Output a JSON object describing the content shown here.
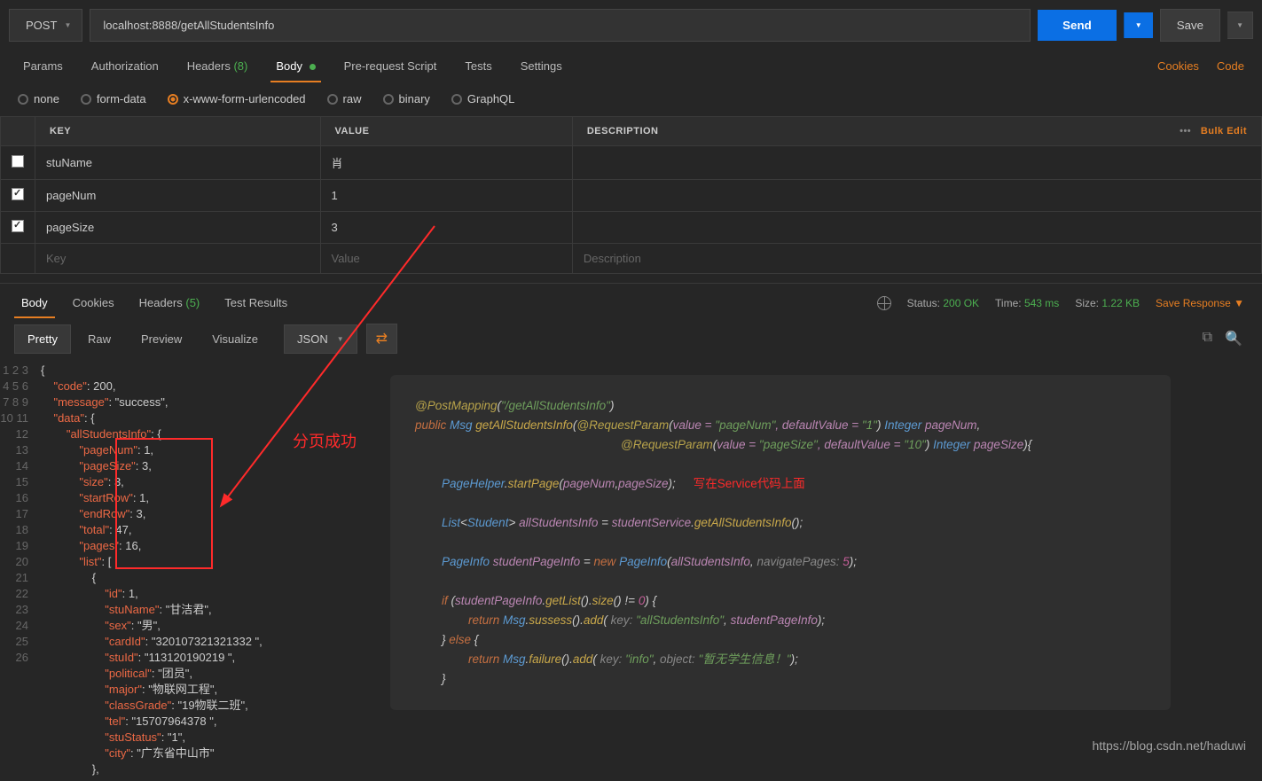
{
  "request": {
    "method": "POST",
    "url": "localhost:8888/getAllStudentsInfo",
    "send": "Send",
    "save": "Save"
  },
  "reqTabs": {
    "params": "Params",
    "auth": "Authorization",
    "headers": "Headers",
    "headersCount": "(8)",
    "body": "Body",
    "prs": "Pre-request Script",
    "tests": "Tests",
    "settings": "Settings",
    "cookies": "Cookies",
    "code": "Code"
  },
  "bodyTypes": {
    "none": "none",
    "formdata": "form-data",
    "urlencoded": "x-www-form-urlencoded",
    "raw": "raw",
    "binary": "binary",
    "graphql": "GraphQL"
  },
  "kv": {
    "headers": {
      "key": "KEY",
      "value": "VALUE",
      "desc": "DESCRIPTION",
      "bulk": "Bulk Edit"
    },
    "rows": [
      {
        "checked": false,
        "k": "stuName",
        "v": "肖"
      },
      {
        "checked": true,
        "k": "pageNum",
        "v": "1"
      },
      {
        "checked": true,
        "k": "pageSize",
        "v": "3"
      }
    ],
    "placeholders": {
      "k": "Key",
      "v": "Value",
      "d": "Description"
    }
  },
  "respTabs": {
    "body": "Body",
    "cookies": "Cookies",
    "headers": "Headers",
    "headersCount": "(5)",
    "tr": "Test Results"
  },
  "status": {
    "statusLabel": "Status:",
    "statusVal": "200 OK",
    "timeLabel": "Time:",
    "timeVal": "543 ms",
    "sizeLabel": "Size:",
    "sizeVal": "1.22 KB",
    "saveResp": "Save Response"
  },
  "viewTabs": {
    "pretty": "Pretty",
    "raw": "Raw",
    "preview": "Preview",
    "visualize": "Visualize",
    "format": "JSON"
  },
  "json": {
    "1": "{",
    "2": "    \"code\": 200,",
    "3": "    \"message\": \"success\",",
    "4": "    \"data\": {",
    "5": "        \"allStudentsInfo\": {",
    "6": "            \"pageNum\": 1,",
    "7": "            \"pageSize\": 3,",
    "8": "            \"size\": 3,",
    "9": "            \"startRow\": 1,",
    "10": "            \"endRow\": 3,",
    "11": "            \"total\": 47,",
    "12": "            \"pages\": 16,",
    "13": "            \"list\": [",
    "14": "                {",
    "15": "                    \"id\": 1,",
    "16": "                    \"stuName\": \"甘洁君\",",
    "17": "                    \"sex\": \"男\",",
    "18": "                    \"cardId\": \"320107321321332 \",",
    "19": "                    \"stuId\": \"113120190219 \",",
    "20": "                    \"political\": \"团员\",",
    "21": "                    \"major\": \"物联网工程\",",
    "22": "                    \"classGrade\": \"19物联二班\",",
    "23": "                    \"tel\": \"15707964378 \",",
    "24": "                    \"stuStatus\": \"1\",",
    "25": "                    \"city\": \"广东省中山市\"",
    "26": "                },"
  },
  "anno": {
    "pagination": "分页成功",
    "serviceNote": "写在Service代码上面"
  },
  "overlay": {
    "l1a": "@PostMapping",
    "l1b": "(",
    "l1c": "\"/getAllStudentsInfo\"",
    "l1d": ")",
    "l2a": "public ",
    "l2b": "Msg ",
    "l2c": "getAllStudentsInfo",
    "l2d": "(",
    "l2e": "@RequestParam",
    "l2f": "(",
    "l2g": "value = ",
    "l2h": "\"pageNum\"",
    "l2i": ", defaultValue = ",
    "l2j": "\"1\"",
    "l2k": ") ",
    "l2l": "Integer ",
    "l2m": "pageNum",
    "l2n": ",",
    "l3e": "@RequestParam",
    "l3f": "(",
    "l3g": "value = ",
    "l3h": "\"pageSize\"",
    "l3i": ", defaultValue = ",
    "l3j": "\"10\"",
    "l3k": ") ",
    "l3l": "Integer ",
    "l3m": "pageSize",
    "l3n": "){",
    "l4a": "PageHelper",
    "l4b": ".",
    "l4c": "startPage",
    "l4d": "(",
    "l4e": "pageNum",
    "l4f": ",",
    "l4g": "pageSize",
    "l4h": ");",
    "l5a": "List",
    "l5b": "<",
    "l5c": "Student",
    "l5d": "> ",
    "l5e": "allStudentsInfo",
    "l5f": " = ",
    "l5g": "studentService",
    "l5h": ".",
    "l5i": "getAllStudentsInfo",
    "l5j": "();",
    "l6a": "PageInfo ",
    "l6b": "studentPageInfo",
    "l6c": " = ",
    "l6d": "new ",
    "l6e": "PageInfo",
    "l6f": "(",
    "l6g": "allStudentsInfo",
    "l6h": ",  ",
    "l6i": "navigatePages: ",
    "l6j": "5",
    "l6k": ");",
    "l7a": "if ",
    "l7b": "(",
    "l7c": "studentPageInfo",
    "l7d": ".",
    "l7e": "getList",
    "l7f": "().",
    "l7g": "size",
    "l7h": "() != ",
    "l7i": "0",
    "l7j": ") {",
    "l8a": "return ",
    "l8b": "Msg",
    "l8c": ".",
    "l8d": "sussess",
    "l8e": "().",
    "l8f": "add",
    "l8g": "( ",
    "l8h": "key: ",
    "l8i": "\"allStudentsInfo\"",
    "l8j": ", ",
    "l8k": "studentPageInfo",
    "l8l": ");",
    "l9a": "} ",
    "l9b": "else ",
    "l9c": "{",
    "l10a": "return ",
    "l10b": "Msg",
    "l10c": ".",
    "l10d": "failure",
    "l10e": "().",
    "l10f": "add",
    "l10g": "( ",
    "l10h": "key: ",
    "l10i": "\"info\"",
    "l10j": ", ",
    "l10k": "object: ",
    "l10l": "\"暂无学生信息！\"",
    "l10m": ");",
    "l11a": "}"
  },
  "watermark": "https://blog.csdn.net/haduwi"
}
